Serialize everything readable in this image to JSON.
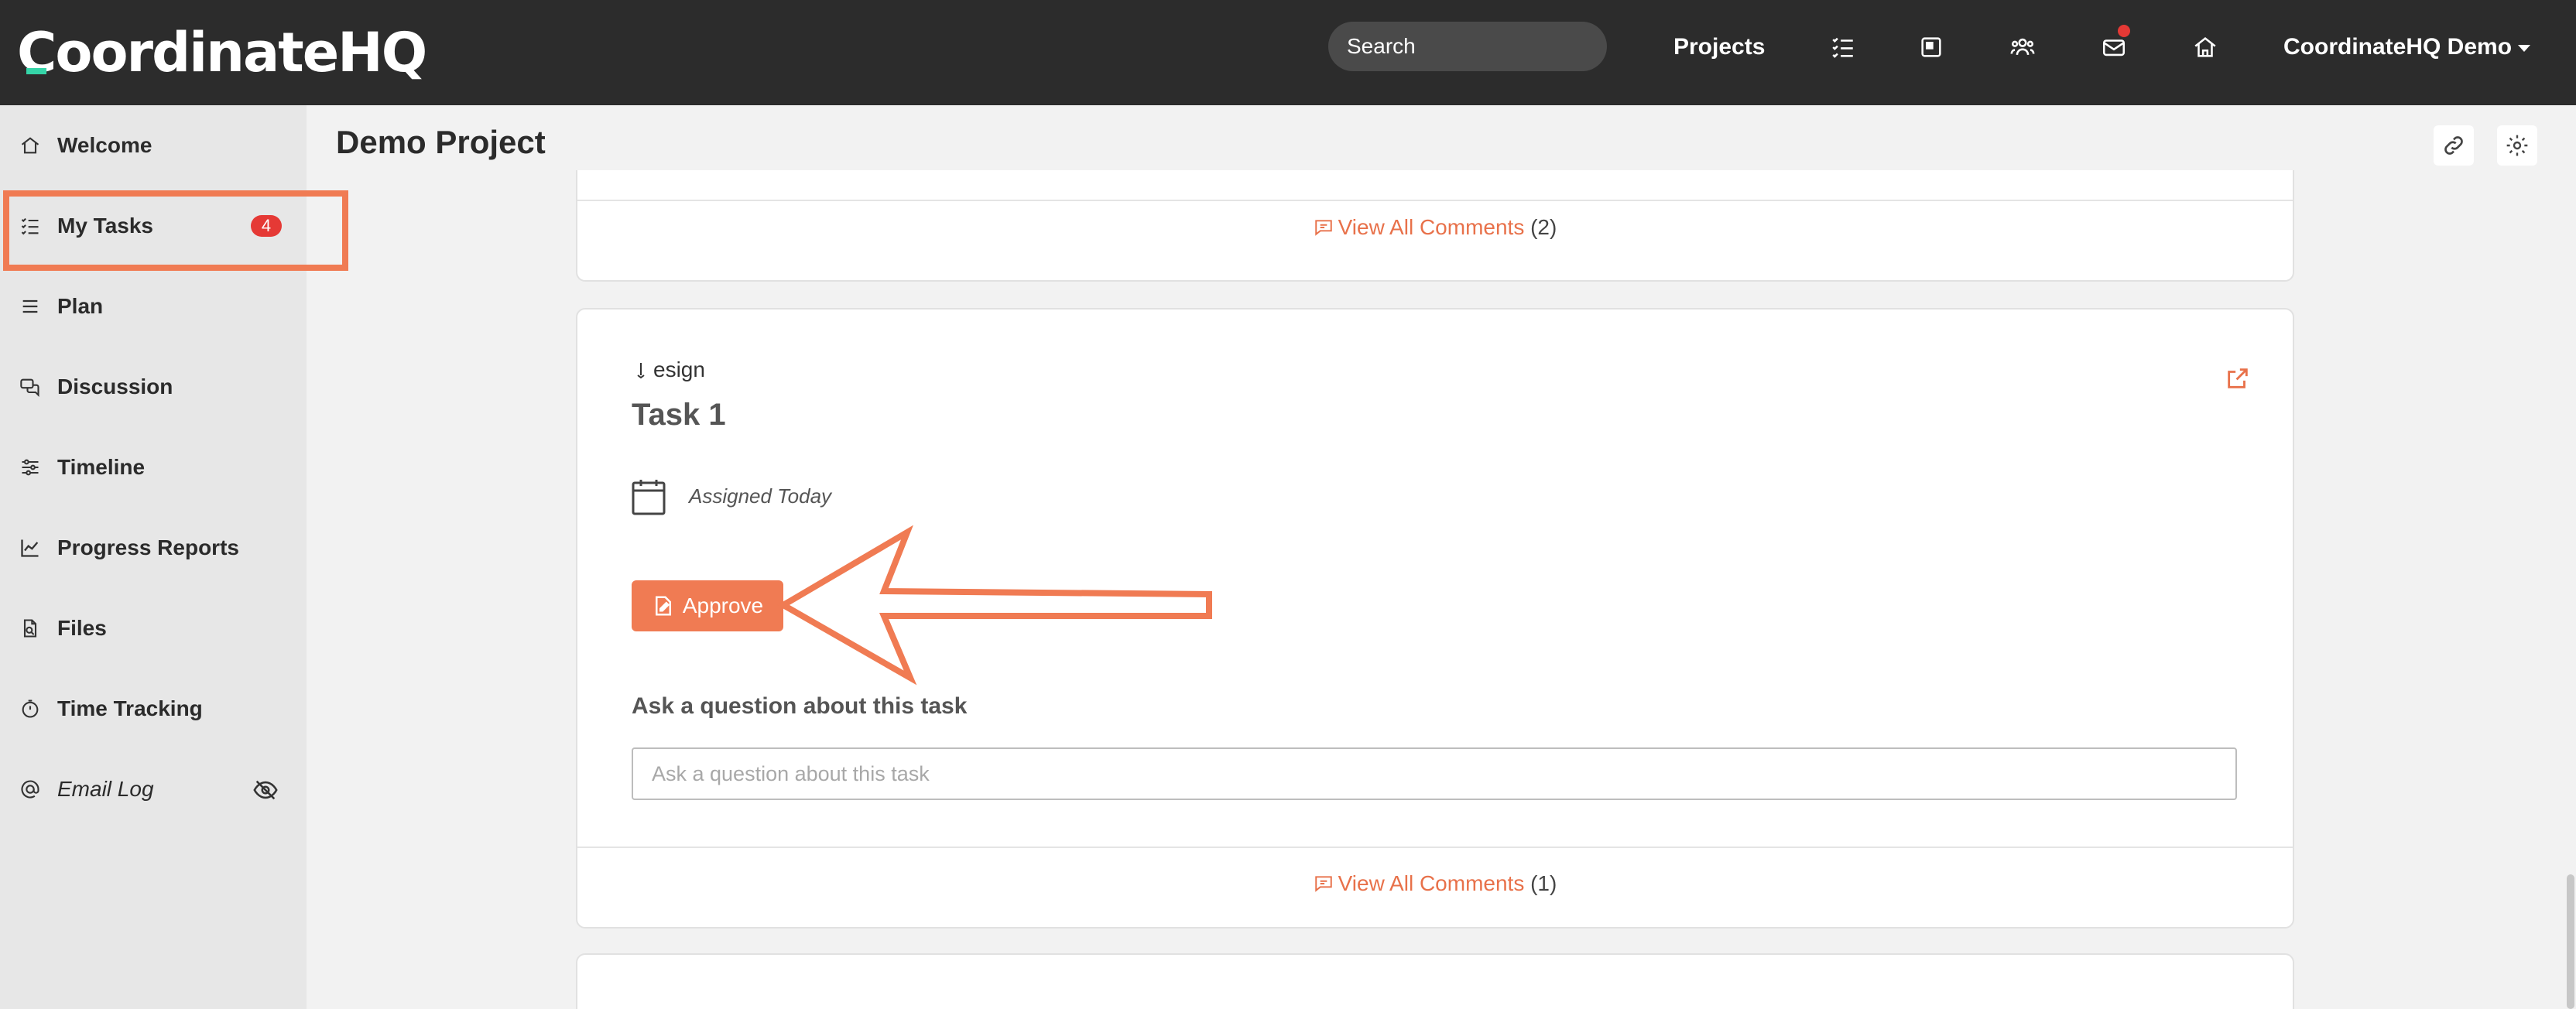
{
  "brand": {
    "logo_text": "CoordinateHQ",
    "accent": "#f07b53",
    "logo_accent": "#35d5a8"
  },
  "topnav": {
    "search_placeholder": "Search",
    "projects_label": "Projects",
    "icons": [
      "tasks-icon",
      "board-icon",
      "users-icon",
      "mail-icon",
      "home-icon"
    ],
    "account_label": "CoordinateHQ Demo"
  },
  "sidebar": {
    "items": [
      {
        "label": "Welcome",
        "icon": "home-icon"
      },
      {
        "label": "My Tasks",
        "icon": "tasks-icon",
        "badge": "4"
      },
      {
        "label": "Plan",
        "icon": "list-icon"
      },
      {
        "label": "Discussion",
        "icon": "chat-icon"
      },
      {
        "label": "Timeline",
        "icon": "sliders-icon"
      },
      {
        "label": "Progress Reports",
        "icon": "chart-icon"
      },
      {
        "label": "Files",
        "icon": "file-search-icon"
      },
      {
        "label": "Time Tracking",
        "icon": "stopwatch-icon"
      },
      {
        "label": "Email Log",
        "icon": "at-icon"
      }
    ]
  },
  "main": {
    "page_title": "Demo Project",
    "top_card": {
      "comments_label": "View All Comments",
      "comments_count": "(2)"
    },
    "task_card": {
      "type_label": "esign",
      "title": "Task 1",
      "assigned": "Assigned Today",
      "approve_label": "Approve",
      "ask_label": "Ask a question about this task",
      "ask_placeholder": "Ask a question about this task",
      "comments_label": "View All Comments",
      "comments_count": "(1)"
    }
  }
}
